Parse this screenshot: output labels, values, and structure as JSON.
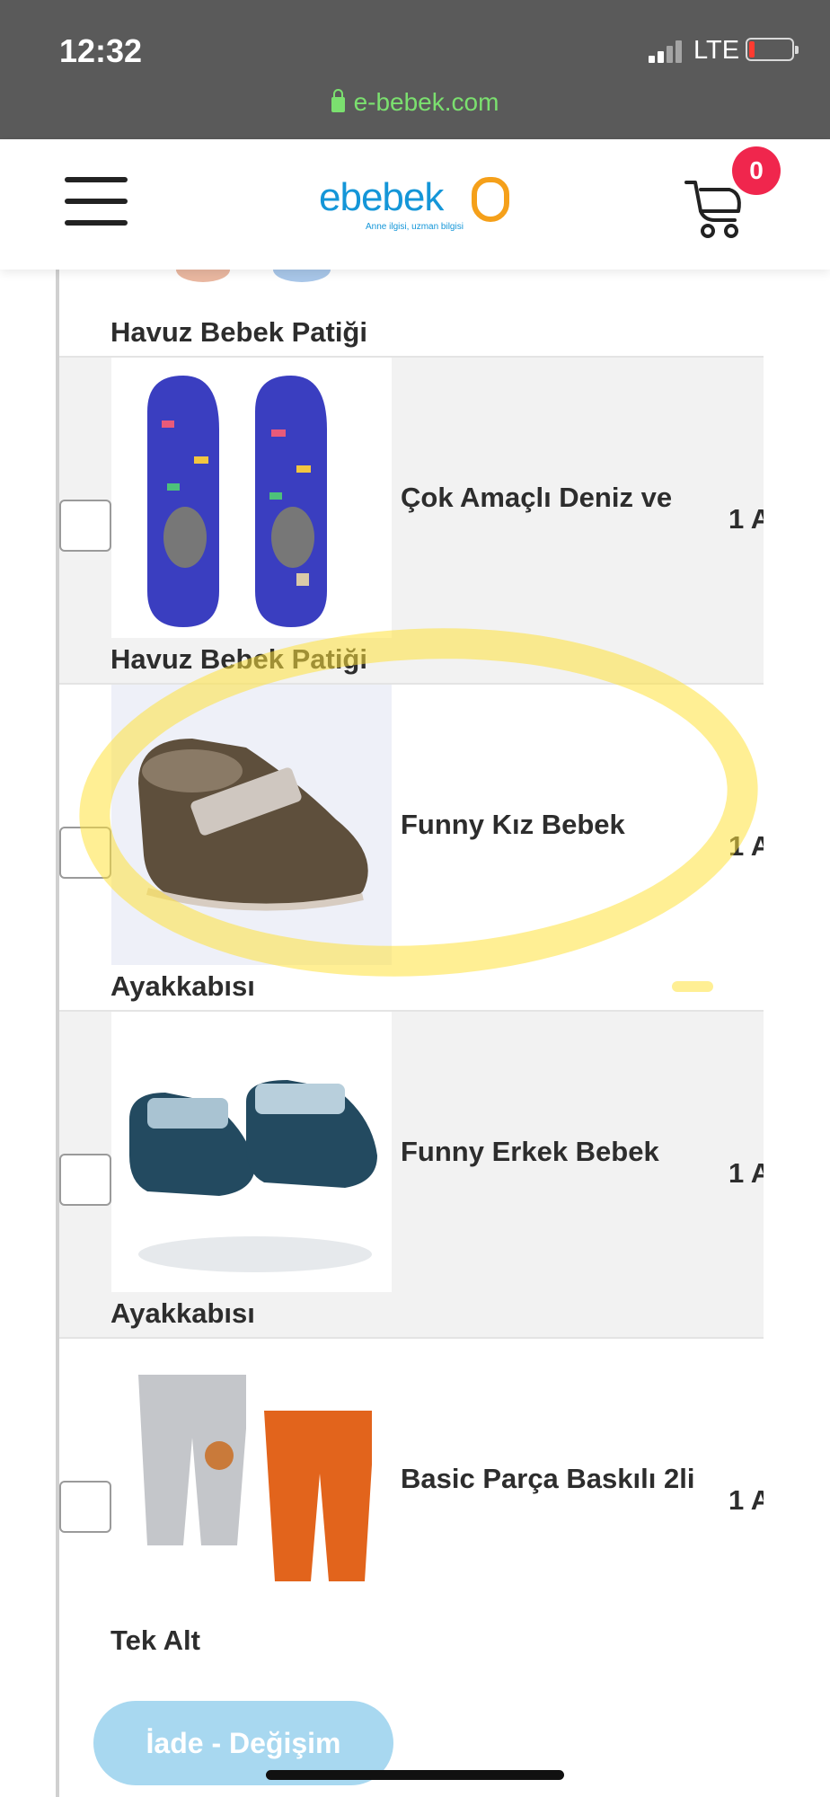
{
  "status_bar": {
    "time": "12:32",
    "network": "LTE",
    "url": "e-bebek.com"
  },
  "header": {
    "logo_text": "ebebek",
    "logo_tagline": "Anne ilgisi, uzman bilgisi",
    "cart_count": "0"
  },
  "colors": {
    "brand_blue": "#1496d8",
    "brand_orange": "#f5a01a",
    "badge_red": "#f0264d",
    "highlight_yellow": "#ffe23c",
    "return_button": "#a8d8f0"
  },
  "products": {
    "top_partial": {
      "name_line2": "Havuz Bebek Patiği"
    },
    "items": [
      {
        "name_line1": "Çok Amaçlı Deniz ve",
        "name_line2": "Havuz Bebek Patiği",
        "qty": "1 A"
      },
      {
        "name_line1": "Funny Kız Bebek",
        "name_line2": "Ayakkabısı",
        "qty": "1 A",
        "highlighted": true
      },
      {
        "name_line1": "Funny Erkek Bebek",
        "name_line2": "Ayakkabısı",
        "qty": "1 A"
      },
      {
        "name_line1": "Basic Parça Baskılı 2li",
        "name_line2": "Tek Alt",
        "qty": "1 A"
      }
    ]
  },
  "actions": {
    "return_label": "İade - Değişim"
  }
}
